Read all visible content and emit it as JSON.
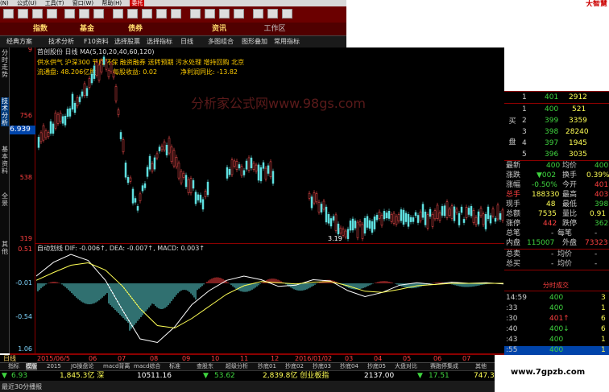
{
  "menubar": {
    "items": [
      "(N)",
      "公式(U)",
      "工具(T)",
      "窗口(W)",
      "帮助(H)",
      "委托"
    ],
    "brand": "大智慧"
  },
  "navbar": {
    "items": [
      "指数",
      "基金",
      "债券",
      "资讯"
    ],
    "workspace": "工作区"
  },
  "toolbar": {
    "items": [
      "经典方案",
      "技术分析",
      "F10资料",
      "选择股票",
      "选择指标",
      "日线",
      "多图组合",
      "图形叠加",
      "常用指标"
    ]
  },
  "sidebar": {
    "tabs": [
      "分时走势",
      "技术分析",
      "基本资料",
      "全景",
      "其他"
    ]
  },
  "chart": {
    "stock_line": "首创股份 日线 MA(5,10,20,40,60,120)",
    "concepts": "供水供气 沪深300 节能环保 融资融券 送转预期 污水处理 增持回购 北京",
    "float_label": "流通盘: 48.206亿股",
    "eps_label": "每股收益: 0.02",
    "profit_label": "净利润同比: -13.82",
    "watermark": "分析家公式网www.98gs.com",
    "current_price": "6.939",
    "y_labels": [
      "756",
      "538",
      "319"
    ],
    "y_label_top": "9",
    "low_label": "3.19",
    "macd_header": "自动划线 DIF: -0.006↑, DEA: -0.007↑, MACD: 0.003↑",
    "macd_labels": [
      "0.51",
      "-0.01",
      "-0.54",
      "1.06"
    ],
    "date_labels": [
      "2015/06/5",
      "06",
      "07",
      "08",
      "09",
      "10",
      "11",
      "12",
      "2016/01/02",
      "03",
      "04",
      "05",
      "06",
      "07"
    ],
    "period_label": "日线",
    "macd_lines": {
      "dif": [
        0.12,
        0.35,
        0.48,
        0.38,
        0.05,
        -0.45,
        -0.92,
        -0.98,
        -0.72,
        -0.35,
        -0.12,
        0.05,
        0.12,
        0.06,
        -0.05,
        -0.03,
        0.06,
        0.04,
        -0.12,
        -0.22,
        -0.15,
        -0.03,
        0.01,
        -0.02,
        0.02,
        0.0,
        0.01,
        -0.01
      ],
      "dea": [
        0.05,
        0.18,
        0.3,
        0.34,
        0.22,
        -0.05,
        -0.42,
        -0.7,
        -0.74,
        -0.58,
        -0.38,
        -0.18,
        -0.04,
        0.03,
        0.01,
        -0.01,
        0.02,
        0.03,
        -0.04,
        -0.13,
        -0.15,
        -0.1,
        -0.04,
        -0.02,
        0.0,
        0.0,
        0.0,
        0.0
      ]
    }
  },
  "bottom_tabs": [
    "指标",
    "模版",
    "2015",
    "JG操盘论",
    "macd背离",
    "macd综合",
    "标准",
    "查股东",
    "超级分析",
    "抄底01",
    "抄底02",
    "抄底03",
    "抄底04",
    "抄底05",
    "大盘对比",
    "赛跑停集成",
    "其他"
  ],
  "ticker": [
    {
      "arrow": "▼",
      "value": "6.93",
      "color": "#3fd43f"
    },
    {
      "value": "1,845.3亿 深",
      "color": "#ffff55"
    },
    {
      "value": "10511.16",
      "color": "#ffffff"
    },
    {
      "arrow": "▼",
      "value": "53.62",
      "color": "#3fd43f"
    },
    {
      "value": "2,839.8亿 创业板指",
      "color": "#ffff55"
    },
    {
      "value": "2137.00",
      "color": "#ffffff"
    },
    {
      "arrow": "▼",
      "value": "17.51",
      "color": "#3fd43f"
    },
    {
      "value": "747.3",
      "color": "#ffff55"
    }
  ],
  "statusbar": "最近30分播报",
  "quote": {
    "order_book": [
      {
        "level": "1",
        "price": "401",
        "vol": "2912"
      },
      {
        "level": "1",
        "price": "400",
        "vol": "521"
      },
      {
        "level": "2",
        "price": "399",
        "vol": "3359"
      },
      {
        "level": "3",
        "price": "398",
        "vol": "28240"
      },
      {
        "level": "4",
        "price": "397",
        "vol": "1945"
      },
      {
        "level": "5",
        "price": "396",
        "vol": "3035"
      }
    ],
    "buy_label": "买盘",
    "rows": [
      {
        "l": "最新",
        "lv": "400",
        "r": "均价",
        "rv": "400"
      },
      {
        "l": "涨跌",
        "lv": "▼002",
        "r": "换手",
        "rv": "0.39%"
      },
      {
        "l": "涨幅",
        "lv": "-0.50%",
        "r": "今开",
        "rv": "401"
      },
      {
        "l": "总手",
        "lv": "188330",
        "r": "最高",
        "rv": "403"
      },
      {
        "l": "现手",
        "lv": "48",
        "r": "最低",
        "rv": "398"
      },
      {
        "l": "总额",
        "lv": "7535",
        "r": "量比",
        "rv": "0.91"
      },
      {
        "l": "涨停",
        "lv": "442",
        "r": "跌停",
        "rv": "362"
      },
      {
        "l": "总笔",
        "lv": "-",
        "r": "每笔",
        "rv": "-"
      },
      {
        "l": "内盘",
        "lv": "115007",
        "r": "外盘",
        "rv": "73323"
      },
      {
        "l": "总卖",
        "lv": "-",
        "r": "均价",
        "rv": "-"
      },
      {
        "l": "总买",
        "lv": "-",
        "r": "均价",
        "rv": "-"
      }
    ],
    "trade_header": "分时成交",
    "trades": [
      {
        "time": "14:59",
        "price": "400",
        "vol": "3"
      },
      {
        "time": ":33",
        "price": "400",
        "vol": "1"
      },
      {
        "time": ":30",
        "price": "401↑",
        "vol": "6"
      },
      {
        "time": ":40",
        "price": "400↓",
        "vol": "6"
      },
      {
        "time": ":43",
        "price": "400",
        "vol": "1"
      },
      {
        "time": ":55",
        "price": "400",
        "vol": "1"
      }
    ]
  },
  "corner_watermark": "www.7gpzb.com"
}
